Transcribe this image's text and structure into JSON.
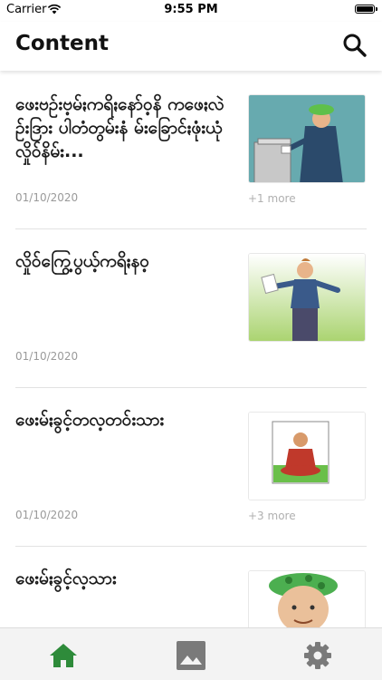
{
  "status_bar": {
    "carrier": "Carrier",
    "time": "9:55 PM"
  },
  "header": {
    "title": "Content",
    "icon": "search-icon"
  },
  "items": [
    {
      "title": "ဖေးဗဥ်းဗ့မ်ႏကရိႏနော်ဝ့နိ ကဖေႏလဲဥ်းဒြား ပါတံတွမ်းနံ မ်းခြောင်ႏဖုံးယုံ လှိုဝ်နိမ်း...",
      "date": "01/10/2020",
      "more": "+1 more",
      "image": "man voting at ballot box"
    },
    {
      "title": "လှိုဝ်ကြွေ့ပွယ့်ကရိႏနဝ့",
      "date": "01/10/2020",
      "more": "",
      "image": "man holding paper"
    },
    {
      "title": "ဖေးမ်ႏခွင့်တလ့တဝ်းသား",
      "date": "01/10/2020",
      "more": "+3 more",
      "image": "seated monk"
    },
    {
      "title": "ဖေးမ်ႏခွင့်လ့သား",
      "date": "",
      "more": "",
      "image": "man with green headwear"
    }
  ],
  "tabs": [
    {
      "name": "home",
      "icon": "home-icon",
      "active": true
    },
    {
      "name": "gallery",
      "icon": "image-icon",
      "active": false
    },
    {
      "name": "settings",
      "icon": "gear-icon",
      "active": false
    }
  ],
  "colors": {
    "active_tab": "#2e8b3a",
    "inactive_tab": "#7a7a7a",
    "date_text": "#9a9a9a"
  }
}
